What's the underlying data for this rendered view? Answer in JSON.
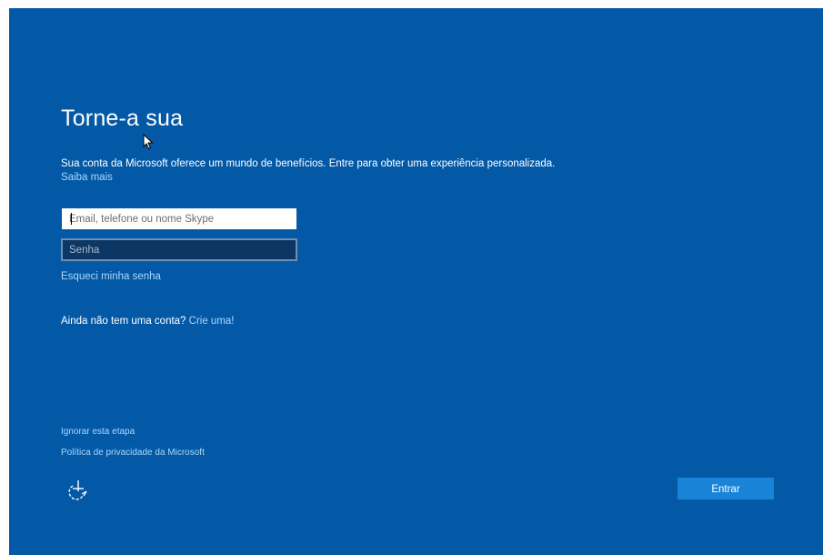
{
  "page": {
    "title": "Torne-a sua",
    "description": "Sua conta da Microsoft oferece um mundo de benefícios. Entre para obter uma experiência personalizada.",
    "learn_more_link": "Saiba mais"
  },
  "form": {
    "email": {
      "placeholder": "Email, telefone ou nome Skype",
      "value": ""
    },
    "password": {
      "placeholder": "Senha",
      "value": ""
    },
    "forgot_password_link": "Esqueci minha senha",
    "no_account_text": "Ainda não tem uma conta?",
    "create_account_link": "Crie uma!"
  },
  "footer": {
    "skip_link": "Ignorar esta etapa",
    "privacy_link": "Política de privacidade da Microsoft",
    "accessibility_icon": "ease-of-access-icon",
    "enter_button": "Entrar"
  },
  "colors": {
    "background": "#0459a6",
    "link": "#a9d7ff",
    "button": "#1883d7",
    "password_field_bg": "#0c3663"
  }
}
